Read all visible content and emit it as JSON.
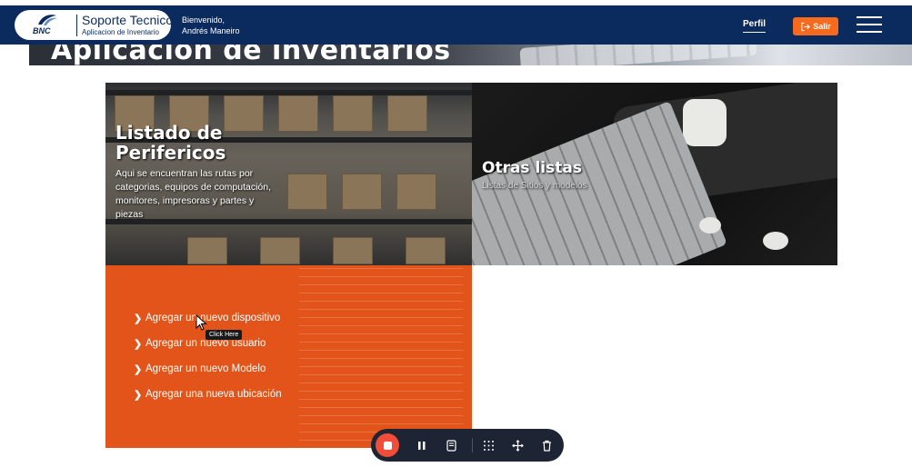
{
  "hero": {
    "title": "Aplicación de inventarios"
  },
  "navbar": {
    "brand_logo_text": "BNC",
    "brand_title": "Soporte Tecnico",
    "brand_subtitle": "Aplicacion de Inventario",
    "welcome_line1": "Bienvenido,",
    "welcome_line2": "Andrés Maneiro",
    "perfil_label": "Perfil",
    "salir_label": "Salir",
    "colors": {
      "navbar_bg": "#0b2b5e",
      "salir_bg": "#f56a1d"
    }
  },
  "cards": {
    "perifericos": {
      "title": "Listado de Perifericos",
      "description": "Aqui se encuentran las rutas por categorias, equipos de computación, monitores, impresoras y partes y piezas"
    },
    "otras": {
      "title": "Otras listas",
      "description": "Listas de Sitios y modelos"
    },
    "actions": {
      "items": [
        "Agregar un nuevo dispositivo",
        "Agregar un nuevo usuario",
        "Agregar un nuevo Modelo",
        "Agregar una nueva ubicación"
      ],
      "color": "#e2541a"
    }
  },
  "tooltip": {
    "text": "Click Here"
  },
  "recorder": {
    "icons": [
      "stop-icon",
      "pause-icon",
      "notes-icon",
      "grid-icon",
      "move-icon",
      "trash-icon"
    ]
  }
}
